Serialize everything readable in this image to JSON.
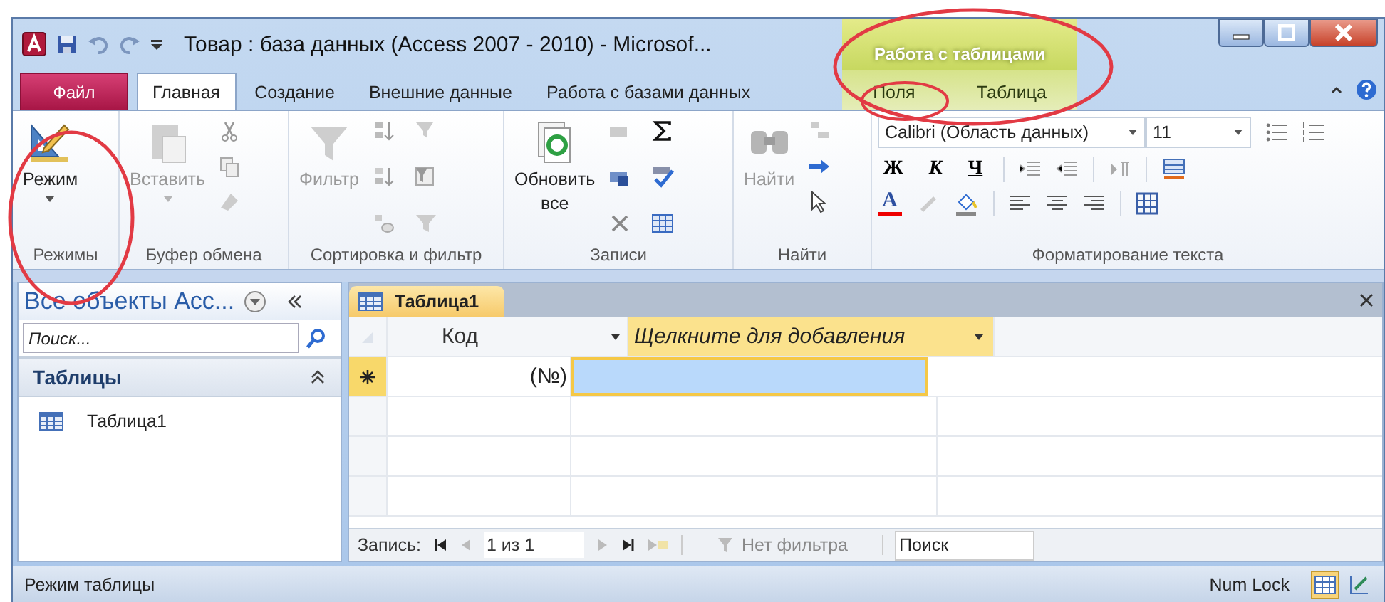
{
  "window": {
    "title": "Товар : база данных (Access 2007 - 2010)  -  Microsof..."
  },
  "context_group": {
    "label": "Работа с таблицами"
  },
  "file_tab": {
    "label": "Файл"
  },
  "tabs": [
    {
      "label": "Главная",
      "selected": true,
      "context": false
    },
    {
      "label": "Создание",
      "selected": false,
      "context": false
    },
    {
      "label": "Внешние данные",
      "selected": false,
      "context": false
    },
    {
      "label": "Работа с базами данных",
      "selected": false,
      "context": false
    },
    {
      "label": "Поля",
      "selected": false,
      "context": true
    },
    {
      "label": "Таблица",
      "selected": false,
      "context": true
    }
  ],
  "ribbon": {
    "groups": [
      {
        "label": "Режимы",
        "button": "Режим",
        "disabled": false
      },
      {
        "label": "Буфер обмена",
        "button": "Вставить",
        "disabled": true
      },
      {
        "label": "Сортировка и фильтр",
        "button": "Фильтр",
        "disabled": true
      },
      {
        "label": "Записи",
        "button": "Обновить",
        "button_line2": "все",
        "disabled": false
      },
      {
        "label": "Найти",
        "button": "Найти",
        "disabled": true
      },
      {
        "label": "Форматирование текста",
        "font": "Calibri (Область данных)",
        "size": "11",
        "bold": "Ж",
        "italic": "К",
        "underline": "Ч",
        "font_color": "A"
      }
    ]
  },
  "nav": {
    "title": "Все объекты Acc...",
    "search_placeholder": "Поиск...",
    "section": "Таблицы",
    "items": [
      "Таблица1"
    ]
  },
  "document": {
    "tab": "Таблица1",
    "columns": [
      "Код",
      "Щелкните для добавления"
    ],
    "new_row": "(№)",
    "record_nav": {
      "label": "Запись:",
      "position": "1 из 1",
      "filter": "Нет фильтра",
      "search_placeholder": "Поиск"
    }
  },
  "status_bar": {
    "text": "Режим таблицы",
    "num_lock": "Num Lock"
  }
}
